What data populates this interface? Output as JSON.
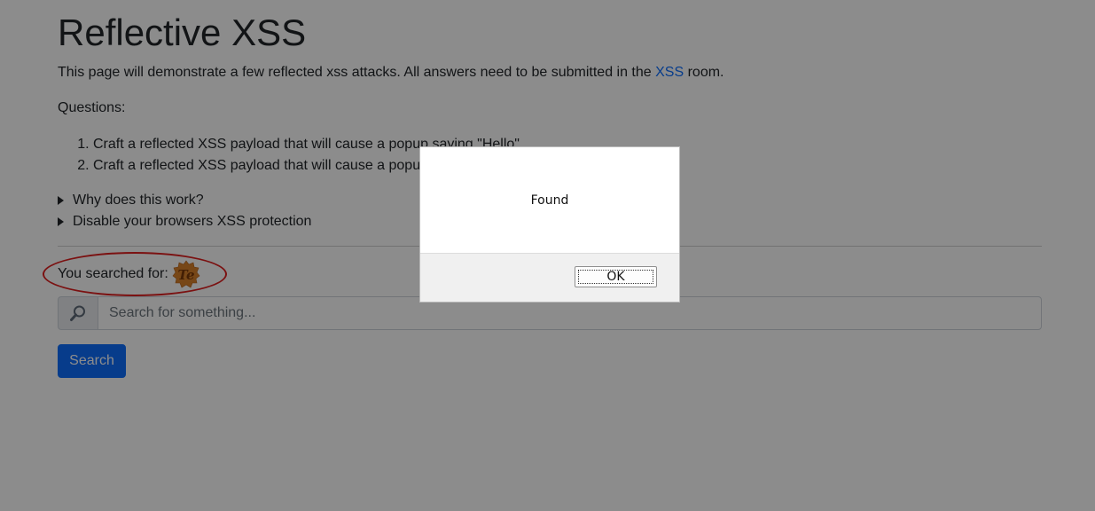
{
  "page": {
    "title": "Reflective XSS",
    "intro_before": "This page will demonstrate a few reflected xss attacks. All answers need to be submitted in the ",
    "intro_link": "XSS",
    "intro_after": " room.",
    "questions_label": "Questions:",
    "questions": [
      "Craft a reflected XSS payload that will cause a popup saying \"Hello\"",
      "Craft a reflected XSS payload that will cause a popup"
    ],
    "details": [
      "Why does this work?",
      "Disable your browsers XSS protection"
    ],
    "searched_label": "You searched for:",
    "badge_text": "Te",
    "search": {
      "placeholder": "Search for something...",
      "value": "",
      "icon": "magnifier-icon",
      "button_label": "Search"
    }
  },
  "dialog": {
    "message": "Found",
    "ok_label": "OK"
  },
  "colors": {
    "link": "#0d6efd",
    "button": "#0d6efd",
    "annotation": "#e02020",
    "badge": "#d9822b"
  }
}
